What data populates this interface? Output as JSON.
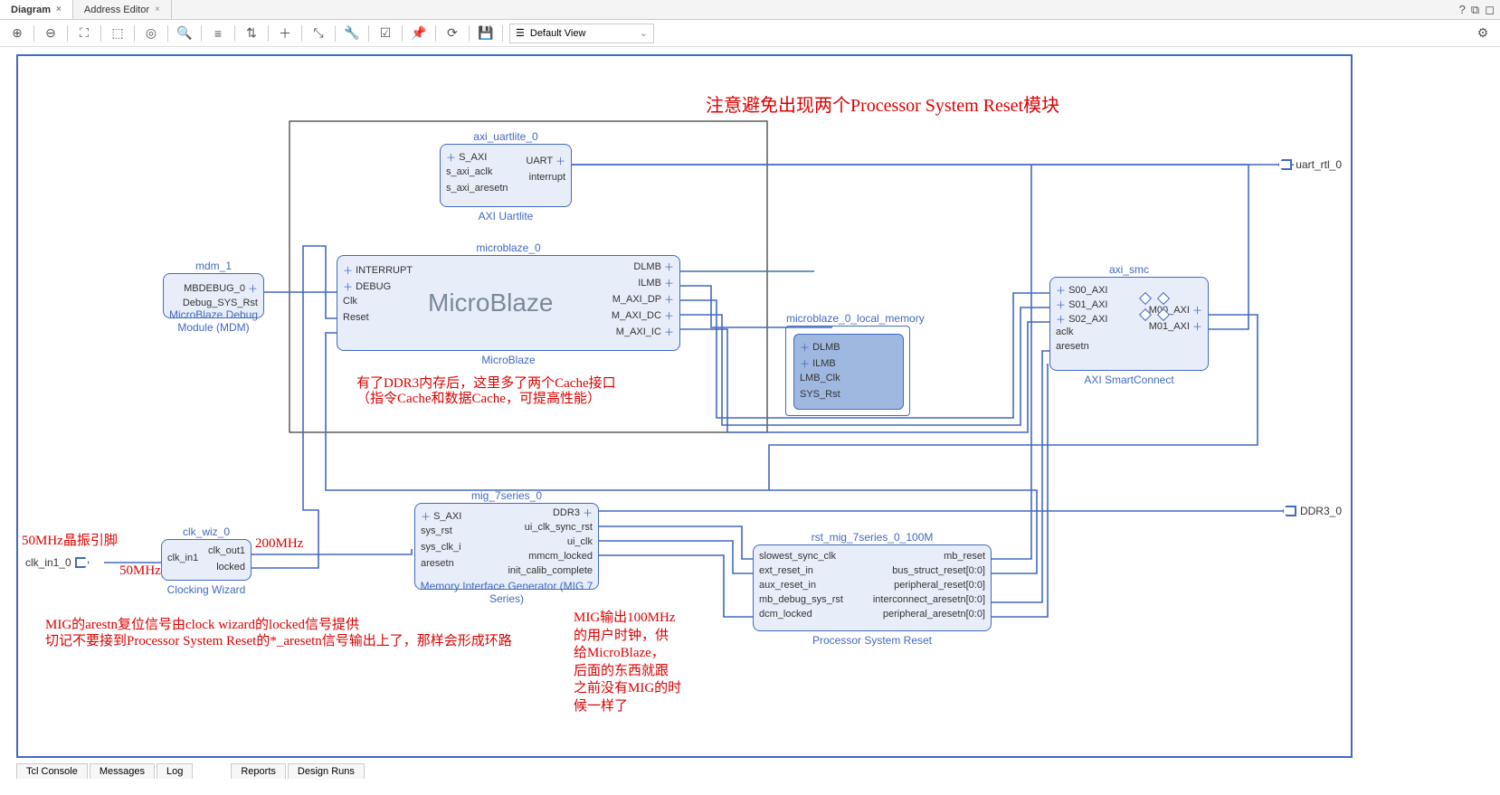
{
  "tabs": {
    "diagram": "Diagram",
    "address": "Address Editor"
  },
  "toolbar": {
    "view": "Default View"
  },
  "ext": {
    "uart": "uart_rtl_0",
    "ddr3": "DDR3_0",
    "clkin": "clk_in1_0"
  },
  "annot": {
    "top": "注意避免出现两个Processor System Reset模块",
    "cache1": "有了DDR3内存后，这里多了两个Cache接口",
    "cache2": "（指令Cache和数据Cache，可提高性能）",
    "crystal": "50MHz晶振引脚",
    "f50": "50MHz",
    "f200": "200MHz",
    "mig_note1": "MIG的arestn复位信号由clock wizard的locked信号提供",
    "mig_note2": "切记不要接到Processor System Reset的*_aresetn信号输出上了，那样会形成环路",
    "mig_clk1": "MIG输出100MHz",
    "mig_clk2": "的用户时钟，供",
    "mig_clk3": "给MicroBlaze，",
    "mig_clk4": "后面的东西就跟",
    "mig_clk5": "之前没有MIG的时",
    "mig_clk6": "候一样了"
  },
  "blocks": {
    "uartlite": {
      "inst": "axi_uartlite_0",
      "name": "AXI Uartlite",
      "ports_l": [
        "S_AXI",
        "s_axi_aclk",
        "s_axi_aresetn"
      ],
      "ports_r": [
        "UART",
        "interrupt"
      ]
    },
    "mb": {
      "inst": "microblaze_0",
      "name": "MicroBlaze",
      "brand": "MicroBlaze",
      "ports_l": [
        "INTERRUPT",
        "DEBUG",
        "Clk",
        "Reset"
      ],
      "ports_r": [
        "DLMB",
        "ILMB",
        "M_AXI_DP",
        "M_AXI_DC",
        "M_AXI_IC"
      ]
    },
    "mdm": {
      "inst": "mdm_1",
      "name": "MicroBlaze Debug Module (MDM)",
      "ports_r": [
        "MBDEBUG_0",
        "Debug_SYS_Rst"
      ]
    },
    "lm": {
      "inst": "microblaze_0_local_memory",
      "ports": [
        "DLMB",
        "ILMB",
        "LMB_Clk",
        "SYS_Rst"
      ]
    },
    "smc": {
      "inst": "axi_smc",
      "name": "AXI SmartConnect",
      "ports_l": [
        "S00_AXI",
        "S01_AXI",
        "S02_AXI",
        "aclk",
        "aresetn"
      ],
      "ports_r": [
        "M00_AXI",
        "M01_AXI"
      ]
    },
    "clkwiz": {
      "inst": "clk_wiz_0",
      "name": "Clocking Wizard",
      "ports_l": [
        "clk_in1"
      ],
      "ports_r": [
        "clk_out1",
        "locked"
      ]
    },
    "mig": {
      "inst": "mig_7series_0",
      "name": "Memory Interface Generator (MIG 7 Series)",
      "ports_l": [
        "S_AXI",
        "sys_rst",
        "sys_clk_i",
        "aresetn"
      ],
      "ports_r": [
        "DDR3",
        "ui_clk_sync_rst",
        "ui_clk",
        "mmcm_locked",
        "init_calib_complete"
      ]
    },
    "psr": {
      "inst": "rst_mig_7series_0_100M",
      "name": "Processor System Reset",
      "ports_l": [
        "slowest_sync_clk",
        "ext_reset_in",
        "aux_reset_in",
        "mb_debug_sys_rst",
        "dcm_locked"
      ],
      "ports_r": [
        "mb_reset",
        "bus_struct_reset[0:0]",
        "peripheral_reset[0:0]",
        "interconnect_aresetn[0:0]",
        "peripheral_aresetn[0:0]"
      ]
    }
  },
  "bottom_tabs": [
    "Tcl Console",
    "Messages",
    "Log",
    "Reports",
    "Design Runs"
  ]
}
